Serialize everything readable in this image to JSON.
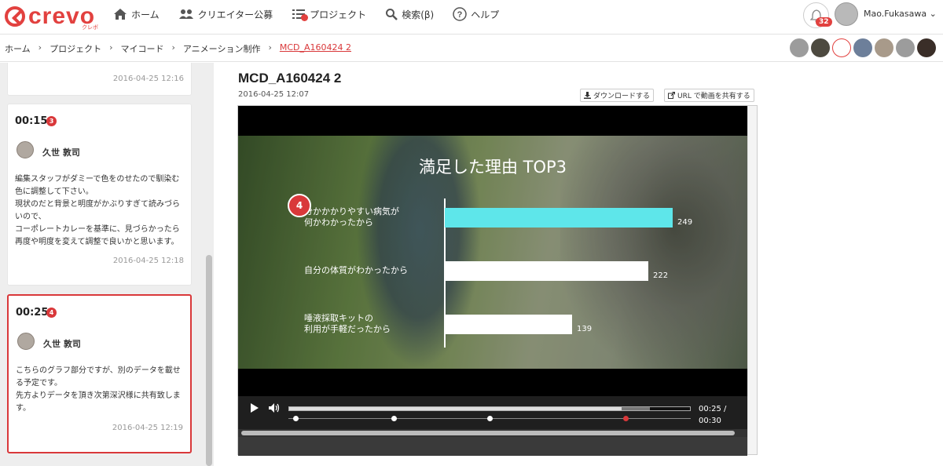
{
  "app": {
    "logo_text": "crevo",
    "logo_sub": "クレボ"
  },
  "nav": {
    "home": "ホーム",
    "creators": "クリエイター公募",
    "projects": "プロジェクト",
    "search": "検索(β)",
    "help": "ヘルプ"
  },
  "user": {
    "notification_count": "32",
    "name": "Mao.Fukasawa"
  },
  "breadcrumb": [
    "ホーム",
    "プロジェクト",
    "マイコード",
    "アニメーション制作",
    "MCD_A160424 2"
  ],
  "comments": [
    {
      "date": "2016-04-25 12:16"
    },
    {
      "time": "00:15",
      "badge": "3",
      "author": "久世 敦司",
      "lines": [
        "編集スタッフがダミーで色をのせたので馴染む",
        "色に調整して下さい。",
        "現状のだと背景と明度がかぶりすぎて読みづら",
        "いので、",
        "コーポレートカレーを基準に、見づらかったら",
        "再度や明度を変えて調整で良いかと思います。"
      ],
      "date": "2016-04-25 12:18"
    },
    {
      "time": "00:25",
      "badge": "4",
      "author": "久世 敦司",
      "lines": [
        "こちらのグラフ部分ですが、別のデータを載せ",
        "る予定です。",
        "先方よりデータを頂き次第深沢様に共有致しま",
        "す。"
      ],
      "date": "2016-04-25 12:19"
    }
  ],
  "video": {
    "title": "MCD_A160424 2",
    "date": "2016-04-25 12:07",
    "download_label": "ダウンロードする",
    "share_label": "URL で動画を共有する",
    "marker": "4",
    "current_time": "00:25 /",
    "duration": "00:30",
    "progress": 0.83,
    "buffered": 0.9
  },
  "chart_data": {
    "type": "bar",
    "title": "満足した理由 TOP3",
    "categories": [
      "分かかかりやすい病気が\n何かわかったから",
      "自分の体質がわかったから",
      "唾液採取キットの\n利用が手軽だったから"
    ],
    "values": [
      249,
      222,
      139
    ],
    "colors": [
      "#5ee6ea",
      "#ffffff",
      "#ffffff"
    ]
  }
}
